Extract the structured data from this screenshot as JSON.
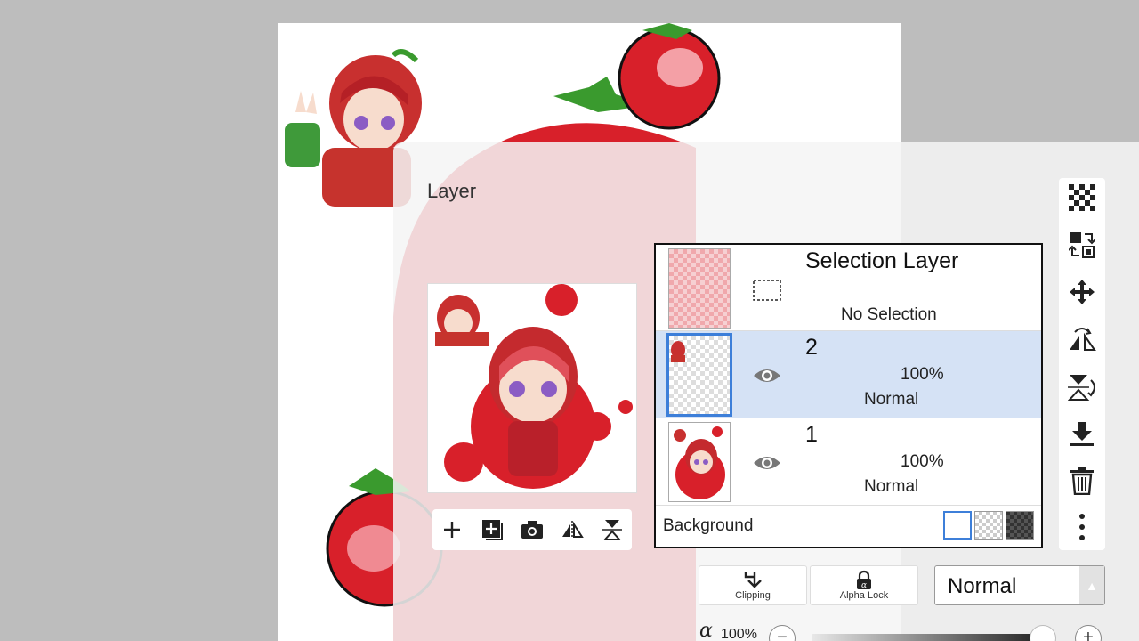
{
  "panel": {
    "title": "Layer"
  },
  "layers": [
    {
      "name": "Selection Layer",
      "status": "No Selection"
    },
    {
      "name": "2",
      "opacity": "100%",
      "mode": "Normal"
    },
    {
      "name": "1",
      "opacity": "100%",
      "mode": "Normal"
    }
  ],
  "background": {
    "label": "Background"
  },
  "buttons": {
    "clipping": "Clipping",
    "alpha_lock": "Alpha Lock"
  },
  "blend_mode": {
    "value": "Normal"
  },
  "opacity_control": {
    "symbol": "α",
    "value": "100%",
    "minus": "−",
    "plus": "+",
    "level": 1.0
  },
  "colors": {
    "accent": "#3d7fd9",
    "selected_row": "#d5e2f5",
    "tomato": "#d8202a",
    "leaf": "#3a9a2e"
  },
  "icons": {
    "preview_toolbar": [
      "plus-icon",
      "add-layer-icon",
      "camera-icon",
      "flip-horizontal-icon",
      "flip-vertical-icon"
    ],
    "right_toolbar": [
      "transparency-icon",
      "layer-copy-icon",
      "move-icon",
      "flip-horizontal-icon",
      "flip-vertical-icon",
      "merge-down-icon",
      "trash-icon",
      "more-icon"
    ]
  }
}
